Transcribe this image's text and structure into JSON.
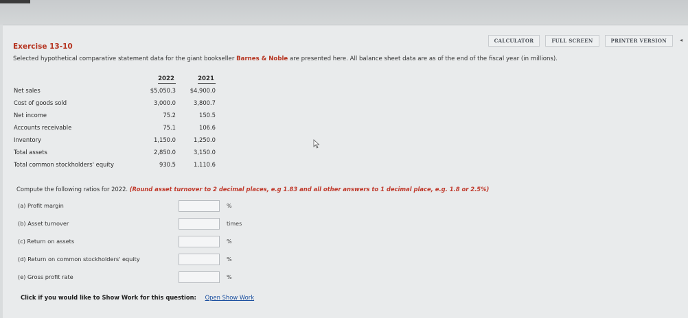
{
  "toolbar": {
    "calculator": "CALCULATOR",
    "full_screen": "FULL SCREEN",
    "printer_version": "PRINTER VERSION",
    "nav": "◂"
  },
  "exercise": {
    "title": "Exercise 13-10",
    "desc_before": "Selected hypothetical comparative statement data for the giant bookseller ",
    "brand": "Barnes & Noble",
    "desc_after": " are presented here. All balance sheet data are as of the end of the fiscal year (in millions)."
  },
  "table": {
    "headers": [
      "2022",
      "2021"
    ],
    "rows": [
      {
        "label": "Net sales",
        "v2022": "$5,050.3",
        "v2021": "$4,900.0"
      },
      {
        "label": "Cost of goods sold",
        "v2022": "3,000.0",
        "v2021": "3,800.7"
      },
      {
        "label": "Net income",
        "v2022": "75.2",
        "v2021": "150.5"
      },
      {
        "label": "Accounts receivable",
        "v2022": "75.1",
        "v2021": "106.6"
      },
      {
        "label": "Inventory",
        "v2022": "1,150.0",
        "v2021": "1,250.0"
      },
      {
        "label": "Total assets",
        "v2022": "2,850.0",
        "v2021": "3,150.0"
      },
      {
        "label": "Total common stockholders' equity",
        "v2022": "930.5",
        "v2021": "1,110.6"
      }
    ]
  },
  "instructions": {
    "lead": "Compute the following ratios for 2022. ",
    "note": "(Round asset turnover to 2 decimal places, e.g 1.83 and all other answers to 1 decimal place, e.g. 1.8 or 2.5%)"
  },
  "questions": [
    {
      "label": "(a)   Profit margin",
      "unit": "%",
      "value": ""
    },
    {
      "label": "(b)   Asset turnover",
      "unit": "times",
      "value": ""
    },
    {
      "label": "(c)   Return on assets",
      "unit": "%",
      "value": ""
    },
    {
      "label": "(d)   Return on common stockholders' equity",
      "unit": "%",
      "value": ""
    },
    {
      "label": "(e)   Gross profit rate",
      "unit": "%",
      "value": ""
    }
  ],
  "show_work": {
    "lead": "Click if you would like to Show Work for this question:",
    "link": "Open Show Work"
  }
}
